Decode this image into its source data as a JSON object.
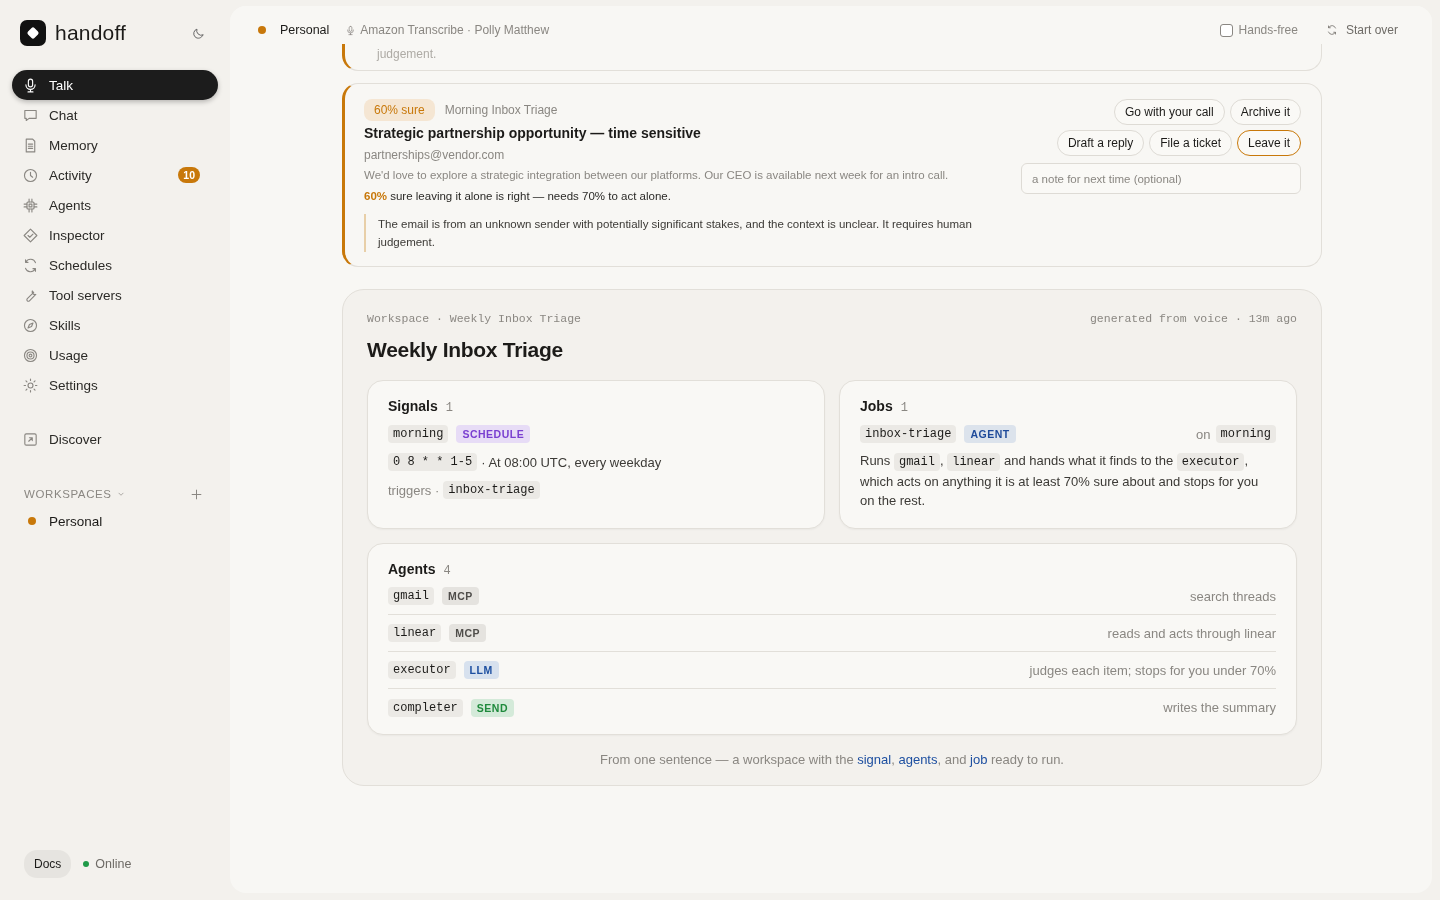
{
  "sidebar": {
    "brand": "handoff",
    "nav": [
      {
        "kind": "mic",
        "label": "Talk",
        "selected": true
      },
      {
        "kind": "chat",
        "label": "Chat",
        "selected": false
      },
      {
        "kind": "doc",
        "label": "Memory",
        "selected": false
      },
      {
        "kind": "clock",
        "label": "Activity",
        "selected": false,
        "badge": "10"
      },
      {
        "kind": "chip",
        "label": "Agents",
        "selected": false
      },
      {
        "kind": "diamond",
        "label": "Inspector",
        "selected": false
      },
      {
        "kind": "refresh",
        "label": "Schedules",
        "selected": false
      },
      {
        "kind": "wrench",
        "label": "Tool servers",
        "selected": false
      },
      {
        "kind": "compass",
        "label": "Skills",
        "selected": false
      },
      {
        "kind": "target",
        "label": "Usage",
        "selected": false
      },
      {
        "kind": "sun",
        "label": "Settings",
        "selected": false
      }
    ],
    "discover": {
      "kind": "external",
      "label": "Discover",
      "selected": false
    },
    "workspaces": {
      "heading": "WORKSPACES",
      "items": [
        {
          "label": "Personal",
          "color": "#c8780a"
        }
      ]
    },
    "docs": "Docs",
    "status": {
      "label": "Online",
      "color": "#1f9a48"
    }
  },
  "header": {
    "workspace": {
      "label": "Personal",
      "color": "#c8780a"
    },
    "voice": "Amazon Transcribe · Polly Matthew",
    "hands_free": {
      "label": "Hands-free",
      "checked": false
    },
    "start_over": "Start over"
  },
  "previous_card": {
    "tail": "judgement."
  },
  "decision": {
    "confidence": "60% sure",
    "source": "Morning Inbox Triage",
    "title": "Strategic partnership opportunity — time sensitive",
    "sender": "partnerships@vendor.com",
    "body": "We'd love to explore a strategic integration between our platforms. Our CEO is available next week for an intro call.",
    "verdict": "**60%** sure leaving it alone is right — needs 70% to act alone.",
    "reason": "The email is from an unknown sender with potentially significant stakes, and the context is unclear. It requires human judgement.",
    "action_rows": [
      {
        "buttons": [
          {
            "label": "Go with your call",
            "selected": false
          },
          {
            "label": "Archive it",
            "selected": false
          }
        ]
      },
      {
        "buttons": [
          {
            "label": "Draft a reply",
            "selected": false
          },
          {
            "label": "File a ticket",
            "selected": false
          },
          {
            "label": "Leave it",
            "selected": true
          }
        ]
      }
    ],
    "note": {
      "placeholder": "a note for next time (optional)"
    }
  },
  "workspace": {
    "breadcrumb": "Workspace · Weekly Inbox Triage",
    "meta": "generated from voice · 13m ago",
    "title": "Weekly Inbox Triage",
    "signals": {
      "heading": "Signals",
      "count": "1",
      "name": "morning",
      "tag": {
        "kind": "schedule",
        "label": "SCHEDULE"
      },
      "cron": "0 8 * * 1-5",
      "schedule_text": "· At 08:00 UTC, every weekday",
      "triggers_label": "triggers ·",
      "triggers": "inbox-triage"
    },
    "jobs": {
      "heading": "Jobs",
      "count": "1",
      "name": "inbox-triage",
      "tag": {
        "kind": "agent",
        "label": "AGENT"
      },
      "on_label": "on",
      "on": "morning",
      "description": [
        {
          "kind": "text",
          "text": "Runs "
        },
        {
          "kind": "code",
          "text": "gmail"
        },
        {
          "kind": "text",
          "text": ", "
        },
        {
          "kind": "code",
          "text": "linear"
        },
        {
          "kind": "text",
          "text": " and hands what it finds to the "
        },
        {
          "kind": "code",
          "text": "executor"
        },
        {
          "kind": "text",
          "text": ", which acts on anything it is at least 70% sure about and stops for you on the rest."
        }
      ]
    },
    "agents": {
      "heading": "Agents",
      "count": "4",
      "rows": [
        {
          "name": "gmail",
          "tag": {
            "kind": "mcp",
            "label": "MCP"
          },
          "description": "search threads"
        },
        {
          "name": "linear",
          "tag": {
            "kind": "mcp",
            "label": "MCP"
          },
          "description": "reads and acts through linear"
        },
        {
          "name": "executor",
          "tag": {
            "kind": "llm",
            "label": "LLM"
          },
          "description": "judges each item; stops for you under 70%"
        },
        {
          "name": "completer",
          "tag": {
            "kind": "send",
            "label": "SEND"
          },
          "description": "writes the summary"
        }
      ]
    },
    "footer": [
      {
        "kind": "text",
        "text": "From one sentence — a workspace with the "
      },
      {
        "kind": "link",
        "text": "signal"
      },
      {
        "kind": "text",
        "text": ", "
      },
      {
        "kind": "link",
        "text": "agents"
      },
      {
        "kind": "text",
        "text": ", and "
      },
      {
        "kind": "link",
        "text": "job"
      },
      {
        "kind": "text",
        "text": " ready to run."
      }
    ]
  }
}
